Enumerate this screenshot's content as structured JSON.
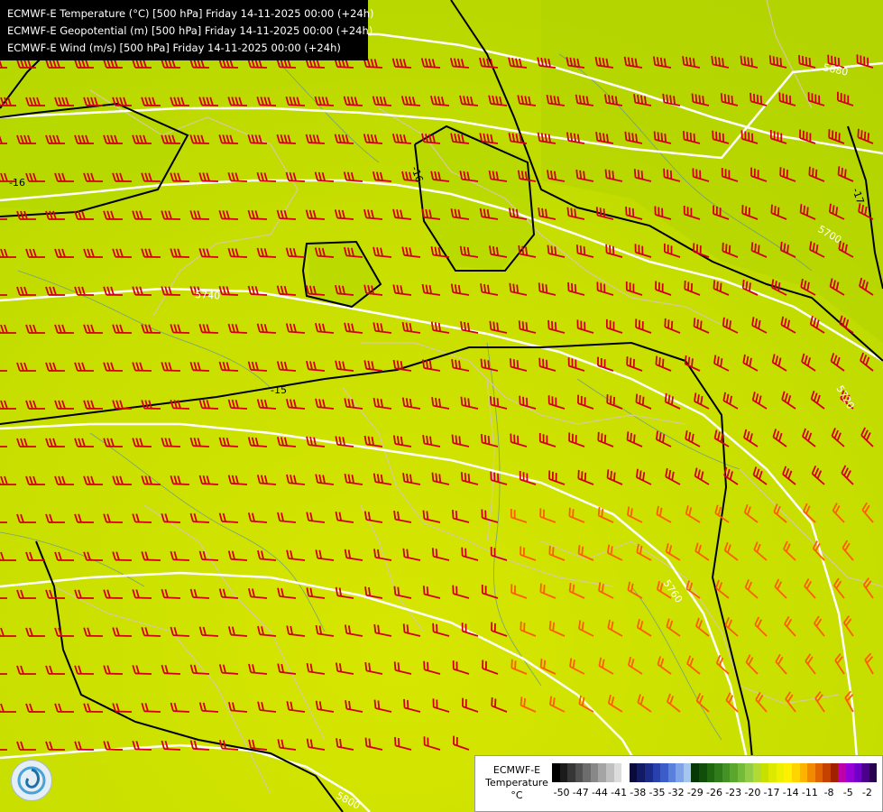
{
  "header": {
    "lines": [
      "ECMWF-E Temperature (°C) [500 hPa] Friday 14-11-2025 00:00 (+24h)",
      "ECMWF-E Geopotential (m) [500 hPa] Friday 14-11-2025 00:00 (+24h)",
      "ECMWF-E Wind (m/s) [500 hPa] Friday 14-11-2025 00:00 (+24h)"
    ]
  },
  "contour_labels": {
    "geopotential": [
      "5680",
      "5700",
      "5720",
      "5740",
      "5760",
      "5800"
    ],
    "temperature": [
      "-16",
      "-16",
      "-15",
      "-17"
    ]
  },
  "legend": {
    "title": "ECMWF-E",
    "subtitle": "Temperature",
    "units": "°C",
    "ticks": [
      "-50",
      "-47",
      "-44",
      "-41",
      "-38",
      "-35",
      "-32",
      "-29",
      "-26",
      "-23",
      "-20",
      "-17",
      "-14",
      "-11",
      "-8",
      "-5",
      "-2"
    ],
    "colors": [
      "#000000",
      "#1b1b1b",
      "#363636",
      "#515151",
      "#6c6c6c",
      "#888888",
      "#a4a4a4",
      "#c0c0c0",
      "#dcdcdc",
      "#ffffff",
      "#0b0b3a",
      "#131a64",
      "#1c2a8a",
      "#2a40ad",
      "#3c5cc8",
      "#5a80db",
      "#7ea3e6",
      "#a6c6f0",
      "#053805",
      "#0f4f0a",
      "#1f6611",
      "#307c1a",
      "#449223",
      "#5ba72e",
      "#75bb3a",
      "#93cd48",
      "#b1db33",
      "#c8e000",
      "#ddea00",
      "#efef00",
      "#ffef00",
      "#ffd500",
      "#ffb200",
      "#f28a00",
      "#df6400",
      "#c44100",
      "#a12000",
      "#c000a8",
      "#9600d6",
      "#7000c8",
      "#4a008a",
      "#2a0050"
    ]
  },
  "map": {
    "background_color": "#c9e000",
    "wind_barb_color": "#d0001d",
    "wind_barb_warm_color": "#ff5b00",
    "geopotential_line_color": "#ffffff",
    "temperature_line_color": "#000000",
    "border_color": "#d8c9a0",
    "river_color": "#5f8fa0"
  }
}
